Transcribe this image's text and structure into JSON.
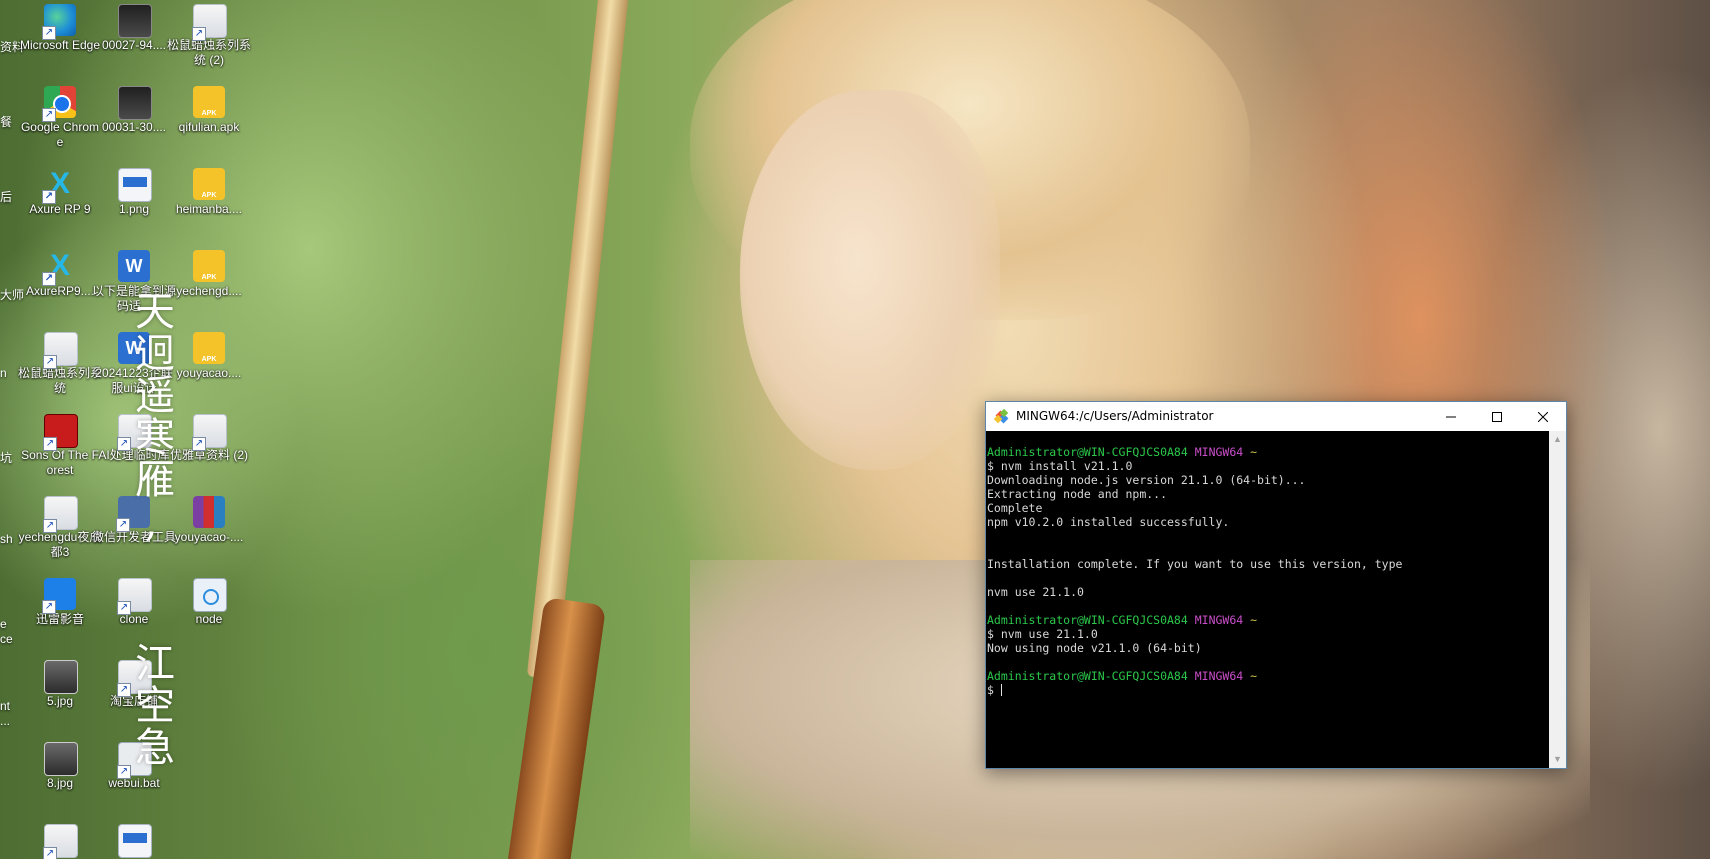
{
  "desktop": {
    "edge_fragments": [
      "资料",
      "餐",
      "后",
      "大师",
      "n",
      "坑",
      "sh",
      "e",
      "ce",
      "nt",
      "..."
    ],
    "columns": [
      [
        {
          "label": "Microsoft Edge",
          "icon": "edge-icon"
        },
        {
          "label": "Google Chrome",
          "icon": "chrome-icon"
        },
        {
          "label": "Axure RP 9",
          "icon": "axure-icon"
        },
        {
          "label": "AxureRP9....",
          "icon": "axure-icon"
        },
        {
          "label": "松鼠蜡烛系列系统",
          "icon": "document-shortcut-icon"
        },
        {
          "label": "Sons Of The Forest",
          "icon": "game-icon"
        },
        {
          "label": "yechengdu夜成都3",
          "icon": "document-shortcut-icon"
        },
        {
          "label": "迅雷影音",
          "icon": "xunlei-icon"
        },
        {
          "label": "5.jpg",
          "icon": "photo-icon"
        },
        {
          "label": "8.jpg",
          "icon": "photo-icon"
        },
        {
          "label": "",
          "icon": "document-shortcut-icon"
        }
      ],
      [
        {
          "label": "00027-94....",
          "icon": "image-thumbnail-icon"
        },
        {
          "label": "00031-30....",
          "icon": "image-thumbnail-icon"
        },
        {
          "label": "1.png",
          "icon": "png-file-icon"
        },
        {
          "label": "以下是能拿到源码适...",
          "icon": "word-document-icon"
        },
        {
          "label": "20241223企联服ui设计",
          "icon": "word-document-icon"
        },
        {
          "label": "AI处理临时库",
          "icon": "folder-shortcut-icon"
        },
        {
          "label": "微信开发者工具",
          "icon": "wechat-devtools-icon"
        },
        {
          "label": "clone",
          "icon": "folder-shortcut-icon"
        },
        {
          "label": "淘宝店铺",
          "icon": "folder-shortcut-icon"
        },
        {
          "label": "webui.bat",
          "icon": "batch-file-icon"
        },
        {
          "label": "",
          "icon": "document-icon"
        }
      ],
      [
        {
          "label": "松鼠蜡烛系列系统 (2)",
          "icon": "document-shortcut-icon"
        },
        {
          "label": "qifulian.apk",
          "icon": "apk-file-icon"
        },
        {
          "label": "heimanba....",
          "icon": "apk-file-icon"
        },
        {
          "label": "yechengd....",
          "icon": "apk-file-icon"
        },
        {
          "label": "youyacao....",
          "icon": "apk-file-icon"
        },
        {
          "label": "优雅草资料 (2)",
          "icon": "document-shortcut-icon"
        },
        {
          "label": "youyacao-....",
          "icon": "rar-archive-icon"
        },
        {
          "label": "node",
          "icon": "node-file-icon"
        }
      ]
    ],
    "poem": {
      "line1": "天迥遥寒雁,",
      "line2": "江空急"
    }
  },
  "terminal": {
    "title": "MINGW64:/c/Users/Administrator",
    "prompt_user": "Administrator@WIN-CGFQJCS0A84",
    "prompt_env": "MINGW64",
    "prompt_dir": "~",
    "lines": [
      {
        "kind": "prompt"
      },
      {
        "kind": "text",
        "text": "$ nvm install v21.1.0"
      },
      {
        "kind": "text",
        "text": "Downloading node.js version 21.1.0 (64-bit)..."
      },
      {
        "kind": "text",
        "text": "Extracting node and npm..."
      },
      {
        "kind": "text",
        "text": "Complete"
      },
      {
        "kind": "text",
        "text": "npm v10.2.0 installed successfully."
      },
      {
        "kind": "text",
        "text": ""
      },
      {
        "kind": "text",
        "text": ""
      },
      {
        "kind": "text",
        "text": "Installation complete. If you want to use this version, type"
      },
      {
        "kind": "text",
        "text": ""
      },
      {
        "kind": "text",
        "text": "nvm use 21.1.0"
      },
      {
        "kind": "text",
        "text": ""
      },
      {
        "kind": "prompt"
      },
      {
        "kind": "text",
        "text": "$ nvm use 21.1.0"
      },
      {
        "kind": "text",
        "text": "Now using node v21.1.0 (64-bit)"
      },
      {
        "kind": "text",
        "text": ""
      },
      {
        "kind": "prompt"
      },
      {
        "kind": "input",
        "text": "$ "
      }
    ],
    "colors": {
      "user": "#2bc84a",
      "env": "#c94ec9",
      "tilde": "#d2c34a",
      "text": "#d8d8d8",
      "background": "#000000"
    }
  }
}
